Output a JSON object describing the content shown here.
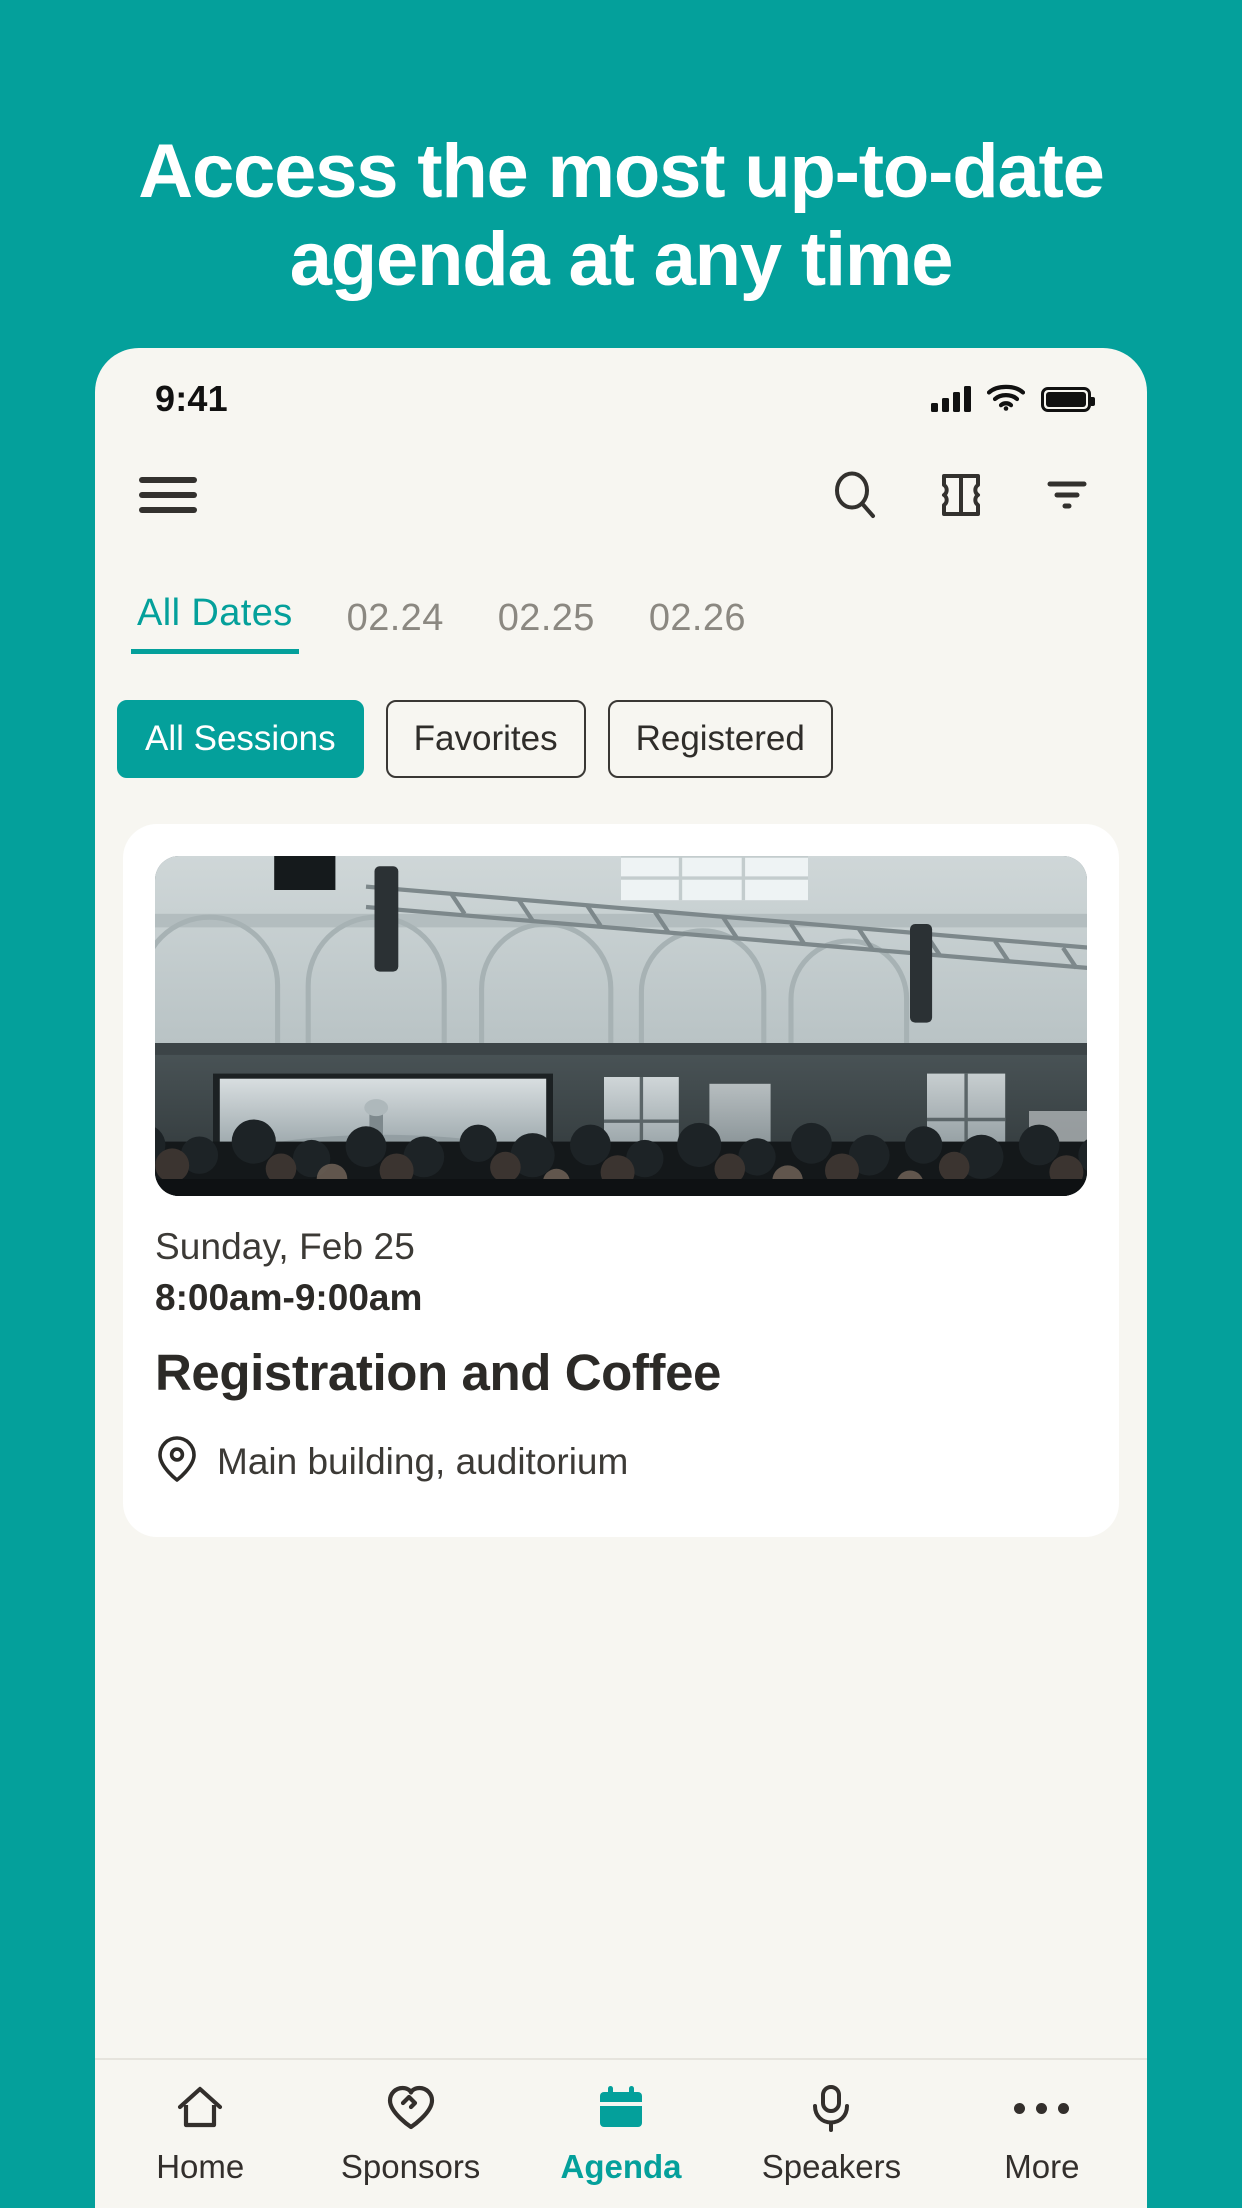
{
  "theme": {
    "accent": "#04a09b",
    "screen_bg": "#f7f6f1",
    "card_bg": "#ffffff",
    "text_dark": "#2c2a27",
    "text_muted": "#8b8881"
  },
  "hero": {
    "headline": "Access the most up-to-date agenda at any time"
  },
  "status_bar": {
    "time": "9:41",
    "signal_icon": "cellular-signal-icon",
    "wifi_icon": "wifi-icon",
    "battery_icon": "battery-full-icon"
  },
  "app_bar": {
    "menu_icon": "hamburger-menu-icon",
    "actions": [
      {
        "name": "search-icon",
        "label": "Search"
      },
      {
        "name": "ticket-icon",
        "label": "Tickets"
      },
      {
        "name": "filter-icon",
        "label": "Filter"
      }
    ]
  },
  "date_tabs": [
    {
      "label": "All Dates",
      "active": true
    },
    {
      "label": "02.24",
      "active": false
    },
    {
      "label": "02.25",
      "active": false
    },
    {
      "label": "02.26",
      "active": false
    }
  ],
  "session_filters": [
    {
      "label": "All Sessions",
      "active": true
    },
    {
      "label": "Favorites",
      "active": false
    },
    {
      "label": "Registered",
      "active": false
    }
  ],
  "sessions": [
    {
      "image_alt": "conference-hall-crowd-photo",
      "date": "Sunday, Feb 25",
      "time": "8:00am-9:00am",
      "title": "Registration and Coffee",
      "location_icon": "map-pin-icon",
      "location": "Main building, auditorium"
    }
  ],
  "bottom_nav": [
    {
      "label": "Home",
      "icon": "home-icon",
      "active": false
    },
    {
      "label": "Sponsors",
      "icon": "heart-handshake-icon",
      "active": false
    },
    {
      "label": "Agenda",
      "icon": "calendar-icon",
      "active": true
    },
    {
      "label": "Speakers",
      "icon": "microphone-icon",
      "active": false
    },
    {
      "label": "More",
      "icon": "more-dots-icon",
      "active": false
    }
  ]
}
